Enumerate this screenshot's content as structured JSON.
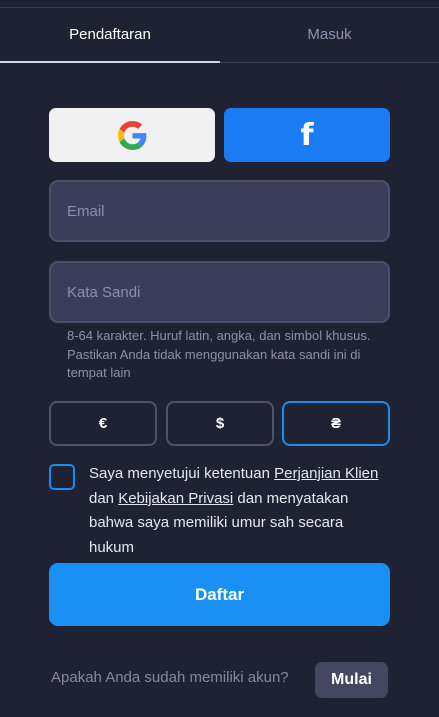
{
  "tabs": {
    "register": "Pendaftaran",
    "login": "Masuk"
  },
  "social": {
    "google_icon": "google-logo",
    "facebook_icon": "f"
  },
  "form": {
    "email_placeholder": "Email",
    "password_placeholder": "Kata Sandi",
    "password_hint": "8-64 karakter. Huruf latin, angka, dan simbol khusus. Pastikan Anda tidak menggunakan kata sandi ini di tempat lain"
  },
  "currencies": {
    "eur": "€",
    "usd": "$",
    "uah": "₴",
    "selected": "uah"
  },
  "agreement": {
    "checked": false,
    "text_1": "Saya menyetujui ketentuan ",
    "link_1": "Perjanjian Klien",
    "text_2": " dan ",
    "link_2": "Kebijakan Privasi",
    "text_3": " dan menyatakan bahwa saya memiliki umur sah secara hukum"
  },
  "submit_label": "Daftar",
  "footer": {
    "question": "Apakah Anda sudah memiliki akun?",
    "login_label": "Mulai"
  },
  "colors": {
    "background": "#1f2233",
    "accent": "#1a90f4",
    "facebook": "#1a7bf2",
    "field_bg": "#3a3e5a"
  }
}
